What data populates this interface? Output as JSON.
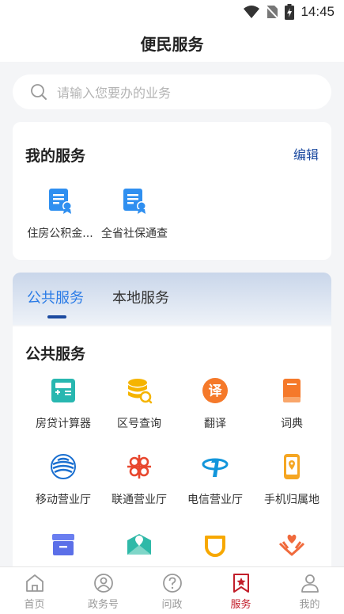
{
  "status_bar": {
    "time": "14:45"
  },
  "header": {
    "title": "便民服务"
  },
  "search": {
    "placeholder": "请输入您要办的业务"
  },
  "my_services": {
    "title": "我的服务",
    "edit_label": "编辑",
    "items": [
      {
        "label": "住房公积金...",
        "icon": "certificate-icon"
      },
      {
        "label": "全省社保通查",
        "icon": "certificate-icon"
      }
    ]
  },
  "tabs": [
    {
      "label": "公共服务",
      "active": true
    },
    {
      "label": "本地服务",
      "active": false
    }
  ],
  "public_services": {
    "title": "公共服务",
    "items": [
      {
        "label": "房贷计算器",
        "icon": "calculator-icon"
      },
      {
        "label": "区号查询",
        "icon": "database-search-icon"
      },
      {
        "label": "翻译",
        "icon": "translate-icon",
        "glyph": "译"
      },
      {
        "label": "词典",
        "icon": "dictionary-icon"
      },
      {
        "label": "移动营业厅",
        "icon": "china-mobile-icon"
      },
      {
        "label": "联通营业厅",
        "icon": "china-unicom-icon"
      },
      {
        "label": "电信营业厅",
        "icon": "china-telecom-icon"
      },
      {
        "label": "手机归属地",
        "icon": "phone-location-icon"
      },
      {
        "label": "",
        "icon": "box-icon"
      },
      {
        "label": "",
        "icon": "map-mail-icon"
      },
      {
        "label": "",
        "icon": "ride-icon"
      },
      {
        "label": "",
        "icon": "charity-hands-icon"
      }
    ]
  },
  "bottom_nav": [
    {
      "label": "首页",
      "icon": "home-icon",
      "active": false
    },
    {
      "label": "政务号",
      "icon": "gov-account-icon",
      "active": false
    },
    {
      "label": "问政",
      "icon": "question-icon",
      "active": false
    },
    {
      "label": "服务",
      "icon": "star-bookmark-icon",
      "active": true
    },
    {
      "label": "我的",
      "icon": "user-icon",
      "active": false
    }
  ],
  "colors": {
    "accent_blue": "#2a7be6",
    "edit_blue": "#1c4aa0",
    "nav_active_red": "#c21e2a"
  }
}
